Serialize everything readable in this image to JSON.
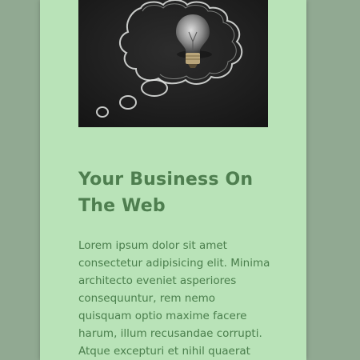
{
  "colors": {
    "page_background": "#91a992",
    "panel_background": "#b9e3b8",
    "heading": "#4e7e4f",
    "body_text": "#4a7e4c"
  },
  "hero_image": {
    "icon": "lightbulb-thought-bubble-icon"
  },
  "article": {
    "title": "Your Business On The Web",
    "body": "Lorem ipsum dolor sit amet consectetur adipisicing elit. Minima architecto eveniet asperiores consequuntur, rem nemo quisquam optio maxime facere harum, illum recusandae corrupti. Atque excepturi et nihil quaerat"
  }
}
